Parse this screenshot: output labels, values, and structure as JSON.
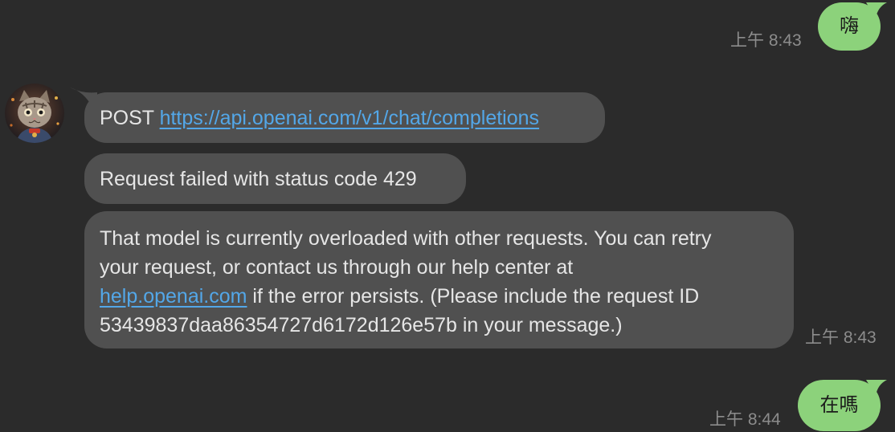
{
  "messages": {
    "outgoing_1": {
      "text": "嗨",
      "time": "上午 8:43"
    },
    "incoming": {
      "bubble1": {
        "prefix": "POST ",
        "url": "https://api.openai.com/v1/chat/completions"
      },
      "bubble2": {
        "text": "Request failed with status code 429"
      },
      "bubble3": {
        "line1": "That model is currently overloaded with other requests. You can retry",
        "line2": "your request, or contact us through our help center at",
        "line3_link": "help.openai.com",
        "line3_rest": " if the error persists. (Please include the request ID",
        "line4": "53439837daa86354727d6172d126e57b in your message.)"
      },
      "time": "上午 8:43"
    },
    "outgoing_2": {
      "text": "在嗎",
      "time": "上午 8:44"
    }
  },
  "colors": {
    "background": "#2b2b2b",
    "incoming_bubble": "#505050",
    "outgoing_bubble": "#8cd27b",
    "link": "#53a7e8",
    "timestamp": "#8c8c8c"
  },
  "avatar": {
    "icon": "cat-avatar-icon"
  }
}
